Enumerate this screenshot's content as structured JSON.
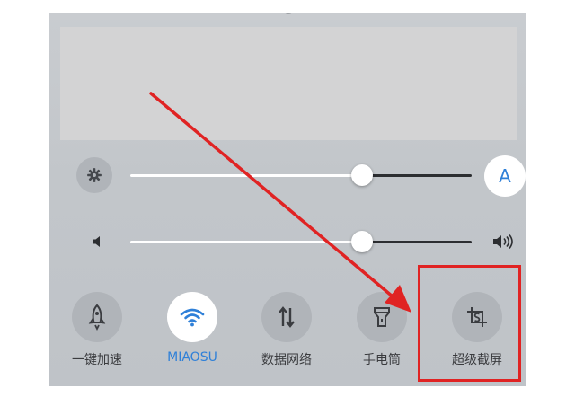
{
  "brightness": {
    "level": 0.68,
    "auto_label": "A"
  },
  "volume": {
    "level": 0.68
  },
  "toggles": [
    {
      "label": "一键加速",
      "icon": "rocket-icon",
      "active": false
    },
    {
      "label": "MIAOSU",
      "icon": "wifi-icon",
      "active": true
    },
    {
      "label": "数据网络",
      "icon": "data-arrows-icon",
      "active": false
    },
    {
      "label": "手电筒",
      "icon": "flashlight-icon",
      "active": false
    },
    {
      "label": "超级截屏",
      "icon": "super-screenshot-icon",
      "active": false
    }
  ],
  "colors": {
    "accent": "#2f80d8",
    "annotation": "#e02323"
  }
}
